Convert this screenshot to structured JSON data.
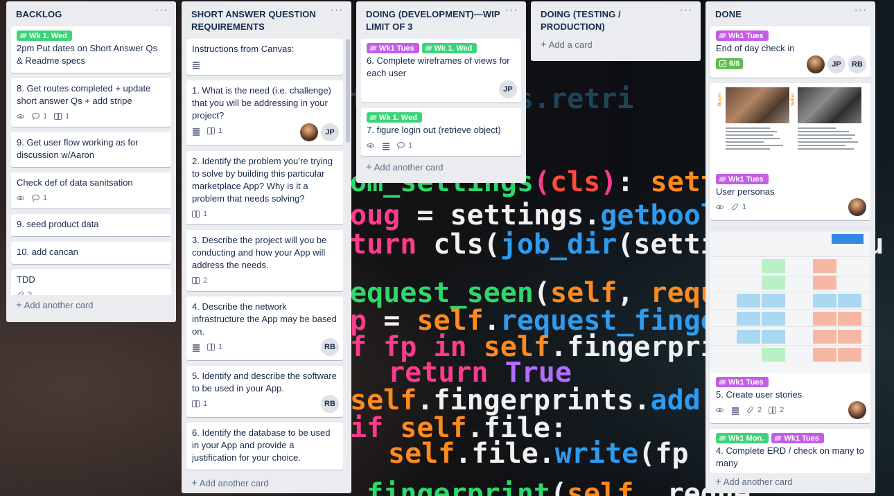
{
  "lists": [
    {
      "title": "BACKLOG",
      "add_label": "Add another card",
      "cards": [
        {
          "labels": [
            {
              "text": "Wk 1. Wed",
              "color": "green"
            }
          ],
          "title": "2pm Put dates on Short Answer Qs & Readme specs"
        },
        {
          "title": "8. Get routes completed + update short answer Qs + add stripe",
          "badges": {
            "watch": true,
            "comments": "1",
            "checklists": "1"
          }
        },
        {
          "title": "9. Get user flow working as for discussion w/Aaron"
        },
        {
          "title": "Check def of data sanitsation",
          "badges": {
            "watch": true,
            "comments": "1"
          }
        },
        {
          "title": "9. seed product data"
        },
        {
          "title": "10. add cancan"
        },
        {
          "title": "TDD",
          "badges": {
            "attachments": "2"
          }
        }
      ]
    },
    {
      "title": "SHORT ANSWER QUESTION REQUIREMENTS",
      "add_label": "Add another card",
      "cards": [
        {
          "title": "Instructions from Canvas:",
          "badges": {
            "description": true
          }
        },
        {
          "title": "1. What is the need (i.e. challenge) that you will be addressing in your project?",
          "badges": {
            "description": true,
            "checklists": "1"
          },
          "members": [
            "photo",
            "JP"
          ]
        },
        {
          "title": "2. Identify the problem you’re trying to solve by building this particular marketplace App? Why is it a problem that needs solving?",
          "badges": {
            "checklists": "1"
          }
        },
        {
          "title": "3. Describe the project will you be conducting and how your App will address the needs.",
          "badges": {
            "checklists": "2"
          }
        },
        {
          "title": "4. Describe the network infrastructure the App may be based on.",
          "badges": {
            "description": true,
            "checklists": "1"
          },
          "members": [
            "RB"
          ]
        },
        {
          "title": "5. Identify and describe the software to be used in your App.",
          "badges": {
            "checklists": "1"
          },
          "members": [
            "RB"
          ]
        },
        {
          "title": "6. Identify the database to be used in your App and provide a justification for your choice."
        }
      ]
    },
    {
      "title": "DOING (DEVELOPMENT)—WIP limit of 3",
      "add_label": "Add another card",
      "cards": [
        {
          "labels": [
            {
              "text": "Wk1 Tues",
              "color": "purple"
            },
            {
              "text": "Wk 1. Wed",
              "color": "green"
            }
          ],
          "title": "6. Complete wireframes of views for each user",
          "members": [
            "JP"
          ]
        },
        {
          "labels": [
            {
              "text": "Wk 1. Wed",
              "color": "green"
            }
          ],
          "title": "7. figure login out (retrieve object)",
          "badges": {
            "watch": true,
            "description": true,
            "comments": "1"
          }
        }
      ]
    },
    {
      "title": "DOING (TESTING / PRODUCTION)",
      "add_label": "Add a card",
      "cards": []
    },
    {
      "title": "DONE",
      "add_label": "Add another card",
      "cards": [
        {
          "labels": [
            {
              "text": "Wk1 Tues",
              "color": "purple"
            }
          ],
          "title": "End of day check in",
          "checklist": "6/6",
          "members": [
            "photo",
            "JP",
            "RB"
          ]
        },
        {
          "cover": "personas",
          "labels": [
            {
              "text": "Wk1 Tues",
              "color": "purple"
            }
          ],
          "title": "User personas",
          "badges": {
            "watch": true,
            "attachments": "1"
          },
          "members": [
            "photo"
          ]
        },
        {
          "cover": "stories",
          "labels": [
            {
              "text": "Wk1 Tues",
              "color": "purple"
            }
          ],
          "title": "5. Create user stories",
          "badges": {
            "watch": true,
            "description": true,
            "attachments": "2",
            "checklists": "2"
          },
          "members": [
            "photo"
          ]
        },
        {
          "labels": [
            {
              "text": "Wk1 Mon.",
              "color": "green"
            },
            {
              "text": "Wk1 Tues",
              "color": "purple"
            }
          ],
          "title": "4. Complete ERD / check on many to many"
        }
      ]
    }
  ],
  "persona_cover": {
    "buyer": "Buyer",
    "seller": "Seller"
  },
  "colors": {
    "list_bg": "#ebecf0",
    "label_green": "#3ed37a",
    "label_purple": "#c45ee6",
    "checklist_done": "#61bd4f"
  }
}
